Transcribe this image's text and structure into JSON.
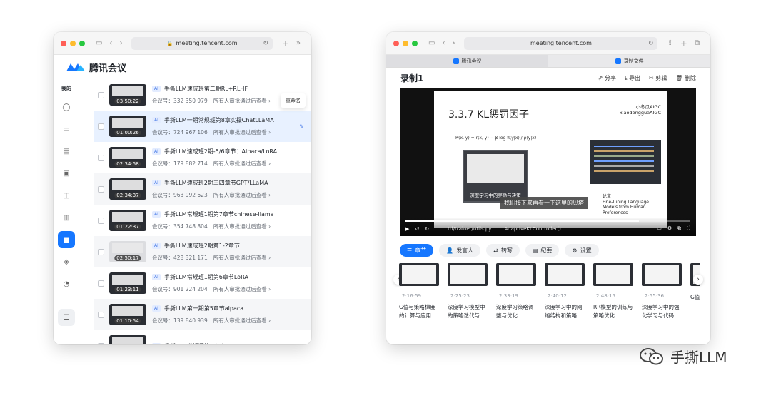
{
  "left_window": {
    "url": "meeting.tencent.com",
    "brand": "腾讯会议",
    "sidebar_header": "我的",
    "tooltip": "重命名",
    "meetings": [
      {
        "ai": "AI",
        "title": "手撕LLM速成班第二期RL+RLHF",
        "duration": "03:50:22",
        "meeting_id_label": "会议号：332 350 979",
        "permission": "所有人审批通过后查看",
        "chevron": "›",
        "variant": "dark"
      },
      {
        "ai": "AI",
        "title": "手撕LLM一期常规班第8章实操ChatLLaMA",
        "duration": "01:00:26",
        "meeting_id_label": "会议号：724 967 106",
        "permission": "所有人审批通过后查看",
        "chevron": "›",
        "variant": "dark"
      },
      {
        "ai": "AI",
        "title": "手撕LLM速成班2期-5/6章节：Alpaca/LoRA",
        "duration": "02:34:58",
        "meeting_id_label": "会议号：179 882 714",
        "permission": "所有人审批通过后查看",
        "chevron": "›",
        "variant": "dark"
      },
      {
        "ai": "AI",
        "title": "手撕LLM速成班2期三四章节GPT/LLaMA",
        "duration": "02:34:37",
        "meeting_id_label": "会议号：963 992 623",
        "permission": "所有人审批通过后查看",
        "chevron": "›",
        "variant": "dark"
      },
      {
        "ai": "AI",
        "title": "手撕LLM常规班1期第7章节chinese-llama",
        "duration": "01:22:37",
        "meeting_id_label": "会议号：354 748 804",
        "permission": "所有人审批通过后查看",
        "chevron": "›",
        "variant": "dark"
      },
      {
        "ai": "AI",
        "title": "手撕LLM速成班2期第1-2章节",
        "duration": "02:50:17",
        "meeting_id_label": "会议号：428 321 171",
        "permission": "所有人审批通过后查看",
        "chevron": "›",
        "variant": "light"
      },
      {
        "ai": "AI",
        "title": "手撕LLM常规班1期第6章节LoRA",
        "duration": "01:23:11",
        "meeting_id_label": "会议号：901 224 204",
        "permission": "所有人审批通过后查看",
        "chevron": "›",
        "variant": "dark"
      },
      {
        "ai": "AI",
        "title": "手撕LLM第一期第5章节alpaca",
        "duration": "01:10:54",
        "meeting_id_label": "会议号：139 840 939",
        "permission": "所有人审批通过后查看",
        "chevron": "›",
        "variant": "dark"
      },
      {
        "ai": "AI",
        "title": "手撕LLM常规版第4章节LLaMA",
        "duration": "",
        "meeting_id_label": "",
        "permission": "",
        "chevron": "",
        "variant": "dark"
      }
    ]
  },
  "right_window": {
    "url": "meeting.tencent.com",
    "tabs": [
      "腾讯会议",
      "录制文件"
    ],
    "recording_title": "录制1",
    "actions": [
      "分享",
      "导出",
      "剪辑",
      "删除"
    ],
    "video": {
      "slide_title": "3.3.7 KL惩罚因子",
      "credit_line1": "小冬瓜AIGC",
      "credit_line2": "xiaodongguaAIGC",
      "formula": "R(x, y) = r(x, y) − β log π(y|x) / ρ(y|x)",
      "pip_caption": "深度学习中的奖励与决策",
      "subtitle": "我们接下来再看一下这里的贝塔",
      "fine_tuning_label": "论文",
      "fine_tuning": "Fine-Tuning Language Models from Human Preferences",
      "file_path": "trl/trainer/utils.py",
      "file_class": "AdaptiveKLController()",
      "progress_fraction": 0.82
    },
    "pills": [
      {
        "label": "章节",
        "icon": "list-icon"
      },
      {
        "label": "发言人",
        "icon": "person-icon"
      },
      {
        "label": "转写",
        "icon": "transcript-icon"
      },
      {
        "label": "纪要",
        "icon": "notes-icon"
      },
      {
        "label": "设置",
        "icon": "gear-icon"
      }
    ],
    "chapters": [
      {
        "time": "2:16:59",
        "title": "G值与策略梯度的计算与应用"
      },
      {
        "time": "2:25:23",
        "title": "深度学习模型中的策略迭代与..."
      },
      {
        "time": "2:33:19",
        "title": "深度学习策略调整与优化"
      },
      {
        "time": "2:40:12",
        "title": "深度学习中的网络结构和策略..."
      },
      {
        "time": "2:48:15",
        "title": "RR模型的训练与策略优化"
      },
      {
        "time": "2:55:36",
        "title": "深度学习中的强化学习与代码..."
      },
      {
        "time": "",
        "title": "G值..."
      }
    ]
  },
  "watermark": "手撕LLM"
}
